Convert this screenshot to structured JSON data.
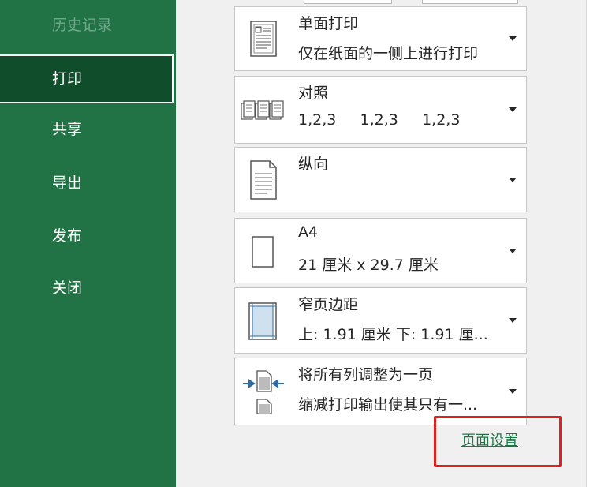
{
  "nav": {
    "history": "历史记录",
    "print": "打印",
    "share": "共享",
    "export": "导出",
    "publish": "发布",
    "close": "关闭"
  },
  "settings": [
    {
      "title": "单面打印",
      "subtitle": "仅在纸面的一侧上进行打印",
      "icon": "single-sided-page-icon"
    },
    {
      "title": "对照",
      "subtitle": "1,2,3     1,2,3     1,2,3",
      "icon": "collated-pages-icon"
    },
    {
      "title": "纵向",
      "subtitle": "",
      "icon": "portrait-page-icon"
    },
    {
      "title": "A4",
      "subtitle": "21 厘米 x 29.7 厘米",
      "icon": "paper-size-icon"
    },
    {
      "title": "窄页边距",
      "subtitle": "上: 1.91 厘米 下: 1.91 厘...",
      "icon": "margins-icon"
    },
    {
      "title": "将所有列调整为一页",
      "subtitle": "缩减打印输出使其只有一...",
      "icon": "fit-columns-icon"
    }
  ],
  "page_setup_link": "页面设置",
  "colors": {
    "sidebar": "#217346",
    "active_nav": "#0f4d2b",
    "highlight": "#e31e1e"
  }
}
